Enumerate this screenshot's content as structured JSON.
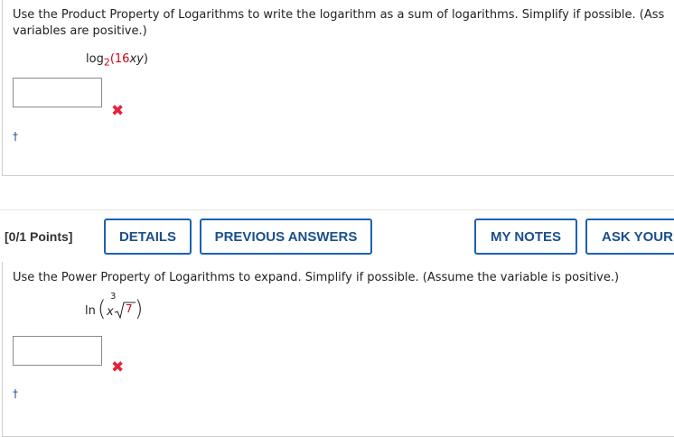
{
  "q1": {
    "prompt_line1": "Use the Product Property of Logarithms to write the logarithm as a sum of logarithms. Simplify if possible. (Ass",
    "prompt_line2": "variables are positive.)",
    "expr_log": "log",
    "expr_base": "2",
    "expr_open": "(",
    "expr_num": "16",
    "expr_vars": "xy",
    "expr_close": ")",
    "answer_value": "",
    "wrong_mark": "✖",
    "dagger": "†"
  },
  "toolbar": {
    "points": "[0/1 Points]",
    "details": "DETAILS",
    "previous_answers": "PREVIOUS ANSWERS",
    "my_notes": "MY NOTES",
    "ask_your": "ASK YOUR"
  },
  "q2": {
    "prompt": "Use the Power Property of Logarithms to expand. Simplify if possible. (Assume the variable is positive.)",
    "expr_ln": "ln",
    "expr_x": "x",
    "expr_index": "3",
    "expr_radicand": "7",
    "answer_value": "",
    "wrong_mark": "✖",
    "dagger": "†"
  },
  "colors": {
    "accent": "#1b62b3",
    "error": "#e8203a",
    "highlight": "#d0021b"
  }
}
